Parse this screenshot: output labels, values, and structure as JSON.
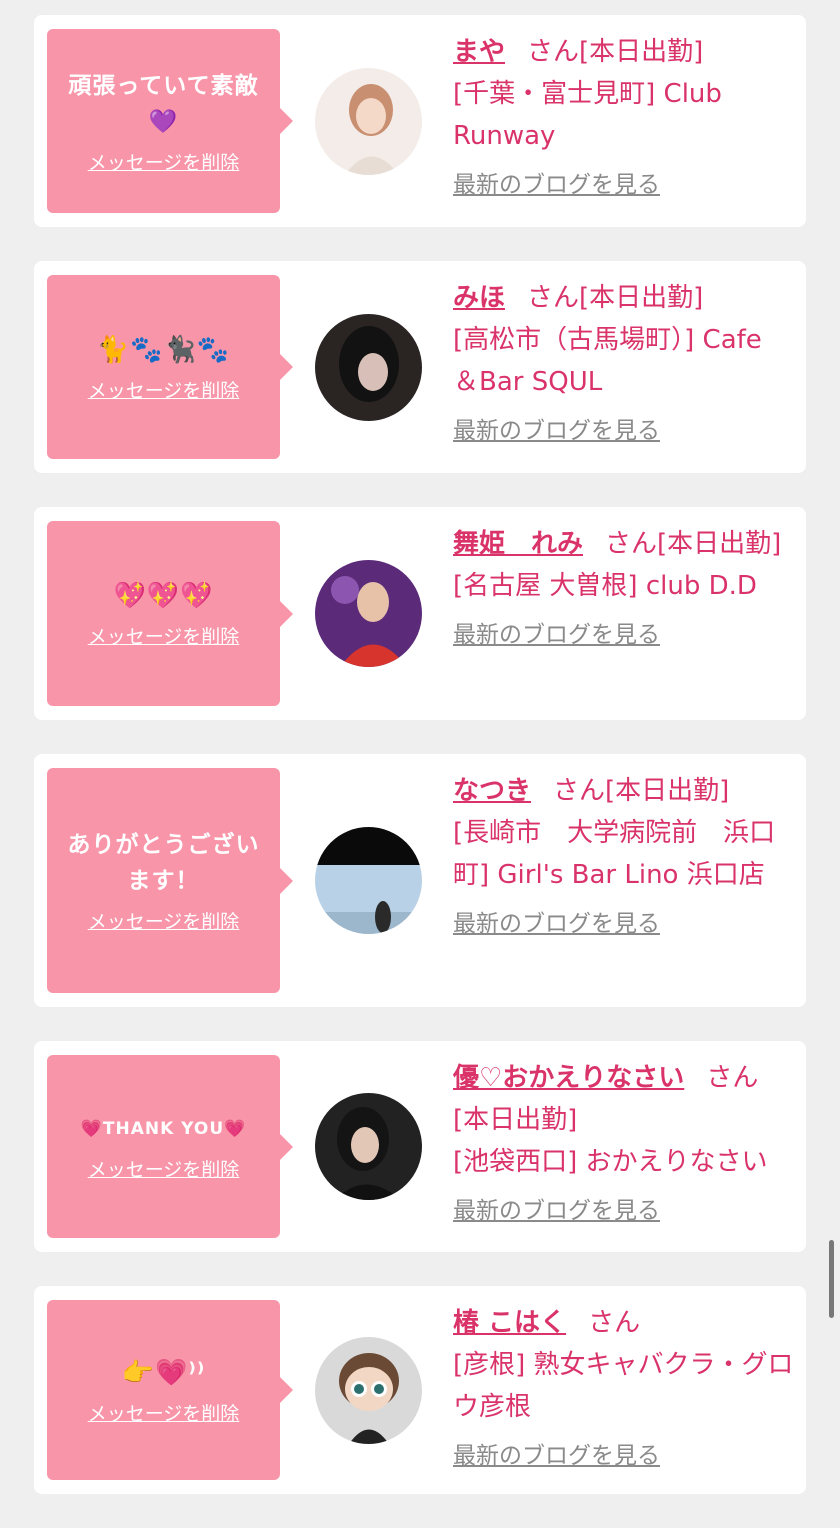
{
  "delete_label": "メッセージを削除",
  "blog_label": "最新のブログを見る",
  "san_label": "さん",
  "cards": [
    {
      "message": "頑張っていて素敵💜",
      "name": "まや",
      "status": "[本日出勤]",
      "shop": "[千葉・富士見町] Club Runway",
      "avatar_colors": [
        "#f1e6e0",
        "#c98f71"
      ]
    },
    {
      "message": "🐈🐾🐈‍⬛🐾",
      "name": "みほ",
      "status": "[本日出勤]",
      "shop": "[高松市（古馬場町）] Cafe ＆Bar SQUL",
      "avatar_colors": [
        "#1a1a1a",
        "#6e5a52"
      ]
    },
    {
      "message": "💖💖💖",
      "name": "舞姫　れみ",
      "status": "[本日出勤]",
      "shop": "[名古屋 大曽根] club D.D",
      "avatar_colors": [
        "#5b2b7a",
        "#d6342d"
      ]
    },
    {
      "message": "ありがとうございます！",
      "name": "なつき",
      "status": "[本日出勤]",
      "shop": "[長崎市　大学病院前　浜口町] Girl's Bar Lino 浜口店",
      "avatar_colors": [
        "#0a0a0a",
        "#b9d1e6"
      ]
    },
    {
      "message": "💗THANK YOU💗",
      "name": "優♡おかえりなさい",
      "status": "[本日出勤]",
      "shop": "[池袋西口] おかえりなさい",
      "avatar_colors": [
        "#222222",
        "#7a5f55"
      ]
    },
    {
      "message": "👉💗⁾⁾",
      "name": "椿 こはく",
      "status": "",
      "shop": "[彦根] 熟女キャバクラ・グロウ彦根",
      "avatar_colors": [
        "#d9d9d9",
        "#6b4a35"
      ]
    }
  ]
}
